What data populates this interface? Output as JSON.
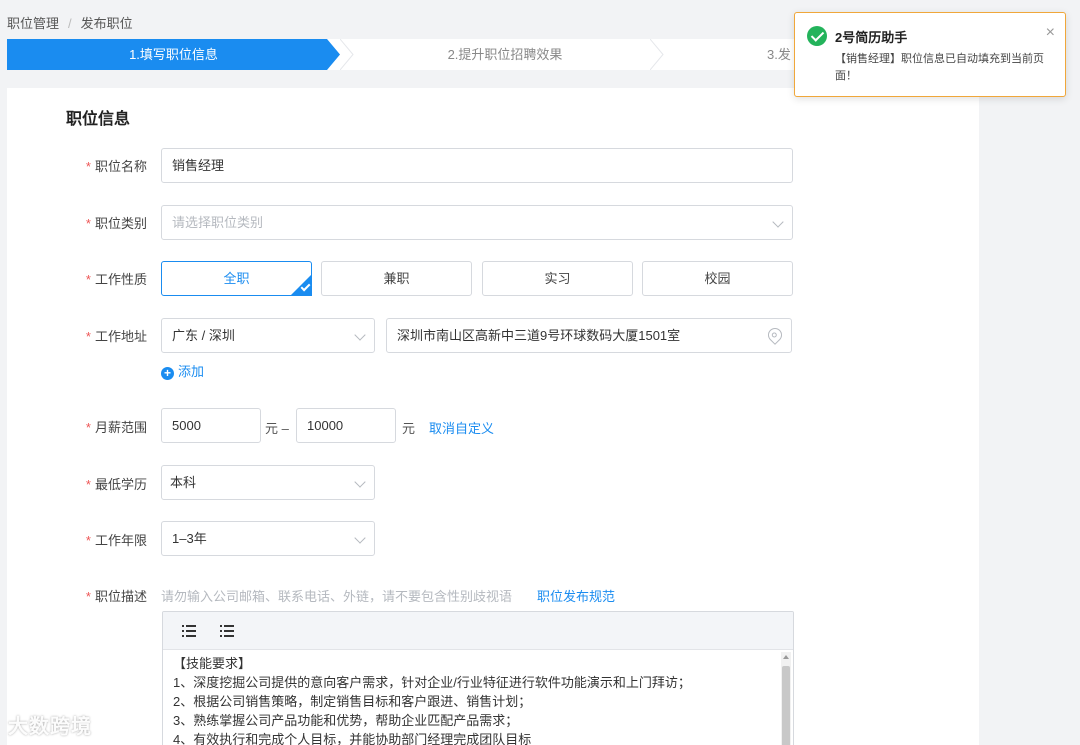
{
  "breadcrumb": {
    "parent": "职位管理",
    "separator": "/",
    "current": "发布职位"
  },
  "steps": [
    {
      "label": "1.填写职位信息"
    },
    {
      "label": "2.提升职位招聘效果"
    },
    {
      "label": "3.发"
    }
  ],
  "form": {
    "section_title": "职位信息",
    "required_mark": "*",
    "job_name": {
      "label": "职位名称",
      "value": "销售经理"
    },
    "job_category": {
      "label": "职位类别",
      "placeholder": "请选择职位类别"
    },
    "job_nature": {
      "label": "工作性质",
      "options": [
        "全职",
        "兼职",
        "实习",
        "校园"
      ],
      "selected": "全职"
    },
    "work_location": {
      "label": "工作地址",
      "region": "广东 / 深圳",
      "address": "深圳市南山区高新中三道9号环球数码大厦1501室",
      "add_label": "添加"
    },
    "salary": {
      "label": "月薪范围",
      "min": "5000",
      "max": "10000",
      "unit": "元",
      "dash": "–",
      "custom_link": "取消自定义"
    },
    "education": {
      "label": "最低学历",
      "value": "本科"
    },
    "experience": {
      "label": "工作年限",
      "value": "1–3年"
    },
    "description": {
      "label": "职位描述",
      "hint": "请勿输入公司邮箱、联系电话、外链，请不要包含性别歧视语",
      "rules_link": "职位发布规范",
      "lines": [
        "【技能要求】",
        "1、深度挖掘公司提供的意向客户需求，针对企业/行业特征进行软件功能演示和上门拜访；",
        "2、根据公司销售策略，制定销售目标和客户跟进、销售计划；",
        "3、熟练掌握公司产品功能和优势，帮助企业匹配产品需求；",
        "4、有效执行和完成个人目标，并能协助部门经理完成团队目标"
      ]
    }
  },
  "toast": {
    "title": "2号简历助手",
    "message": "【销售经理】职位信息已自动填充到当前页面！",
    "close": "×"
  },
  "watermark": "大数跨境"
}
